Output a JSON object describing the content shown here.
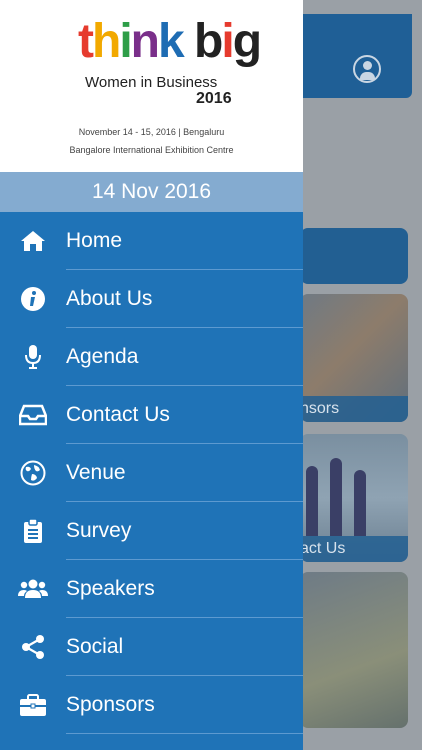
{
  "brand": {
    "logo_text": "think big",
    "subtitle": "Women in Business",
    "year": "2016",
    "dates_line": "November 14 - 15, 2016  |  Bengaluru",
    "venue_line": "Bangalore International Exhibition Centre",
    "colors": [
      "#e63b2e",
      "#f2a900",
      "#2e9e48",
      "#7a2f8a",
      "#1e6cb3",
      "#222222"
    ]
  },
  "drawer": {
    "date": "14 Nov 2016",
    "items": [
      {
        "label": "Home",
        "icon": "home-icon"
      },
      {
        "label": "About Us",
        "icon": "info-icon"
      },
      {
        "label": "Agenda",
        "icon": "microphone-icon"
      },
      {
        "label": "Contact Us",
        "icon": "inbox-icon"
      },
      {
        "label": "Venue",
        "icon": "globe-icon"
      },
      {
        "label": "Survey",
        "icon": "clipboard-icon"
      },
      {
        "label": "Speakers",
        "icon": "users-icon"
      },
      {
        "label": "Social",
        "icon": "share-icon"
      },
      {
        "label": "Sponsors",
        "icon": "briefcase-icon"
      }
    ]
  },
  "background": {
    "tile_b_label": "nsors",
    "tile_c_label": "act Us"
  },
  "colors": {
    "drawer_bg": "#1f73b7",
    "date_bar_bg": "#84abd0",
    "header_bg": "#1f5f96"
  }
}
